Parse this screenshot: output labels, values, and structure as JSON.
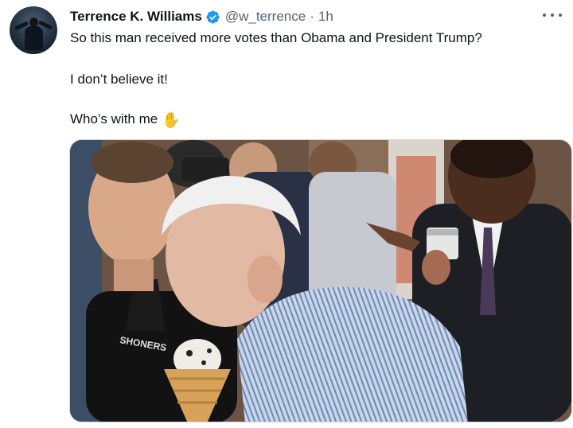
{
  "tweet": {
    "author_name": "Terrence K. Williams",
    "author_handle": "@w_terrence",
    "separator": "·",
    "timestamp": "1h",
    "lines": [
      "So this man received more votes than Obama and President Trump?",
      "I don’t believe it!",
      "Who’s with me"
    ],
    "emoji": "✋",
    "shirt_text": "SHONERS"
  },
  "colors": {
    "verified_blue": "#1d9bf0",
    "secondary_text": "#536471",
    "primary_text": "#0f1419"
  },
  "icons": {
    "verified": "verified-badge-icon",
    "more": "more-options-icon",
    "hand": "raised-hand-icon"
  }
}
